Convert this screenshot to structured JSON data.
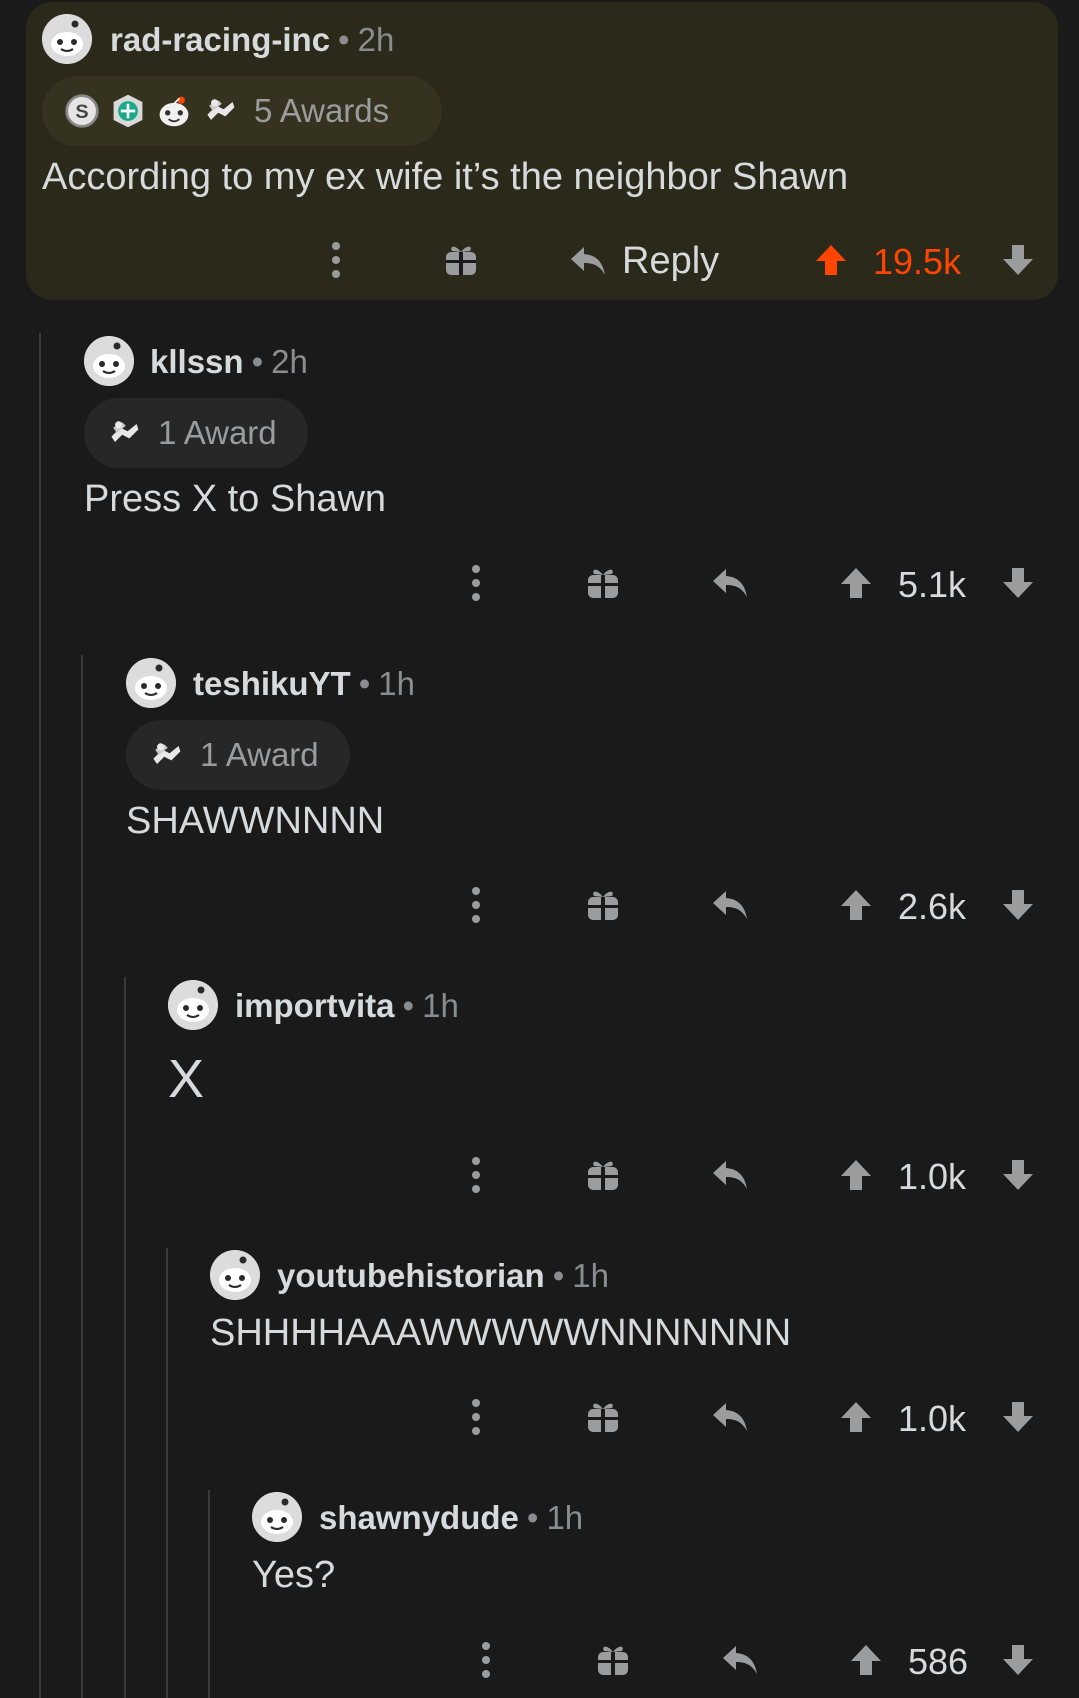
{
  "colors": {
    "background": "#1a1a1a",
    "highlight": "#2b2919",
    "upvoted": "#ff4500",
    "muted": "#8a8d8f",
    "text": "#d7dadc"
  },
  "comments": [
    {
      "username": "rad-racing-inc",
      "separator": "•",
      "time": "2h",
      "awards_label": "5 Awards",
      "award_icons": [
        "silver-award-icon",
        "helpful-award-icon",
        "wholesome-award-icon",
        "hugz-award-icon"
      ],
      "body": "According to my ex wife it’s the neighbor Shawn",
      "reply_label": "Reply",
      "score": "19.5k",
      "upvoted": true,
      "highlighted": true
    },
    {
      "username": "kllssn",
      "separator": "•",
      "time": "2h",
      "awards_label": "1 Award",
      "award_icons": [
        "hugz-award-icon"
      ],
      "body": "Press X to Shawn",
      "score": "5.1k"
    },
    {
      "username": "teshikuYT",
      "separator": "•",
      "time": "1h",
      "awards_label": "1 Award",
      "award_icons": [
        "hugz-award-icon"
      ],
      "body": "SHAWWNNNN",
      "score": "2.6k"
    },
    {
      "username": "importvita",
      "separator": "•",
      "time": "1h",
      "body": "X",
      "score": "1.0k"
    },
    {
      "username": "youtubehistorian",
      "separator": "•",
      "time": "1h",
      "body": "SHHHHAAAWWWWWNNNNNNN",
      "score": "1.0k"
    },
    {
      "username": "shawnydude",
      "separator": "•",
      "time": "1h",
      "body": "Yes?",
      "score": "586"
    }
  ]
}
